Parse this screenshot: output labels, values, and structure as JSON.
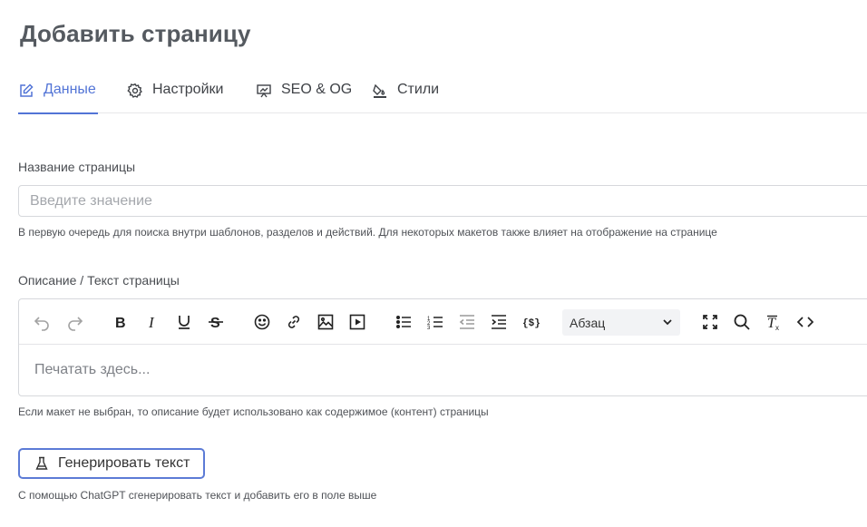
{
  "page": {
    "title": "Добавить страницу"
  },
  "tabs": [
    {
      "label": "Данные",
      "icon": "edit-icon",
      "active": true
    },
    {
      "label": "Настройки",
      "icon": "gear-icon",
      "active": false
    },
    {
      "label": "SEO & OG",
      "icon": "presentation-icon",
      "active": false
    },
    {
      "label": "Стили",
      "icon": "paint-bucket-icon",
      "active": false
    }
  ],
  "page_name": {
    "label": "Название страницы",
    "placeholder": "Введите значение",
    "value": "",
    "hint": "В первую очередь для поиска внутри шаблонов, разделов и действий. Для некоторых макетов также влияет на отображение на странице"
  },
  "description": {
    "label": "Описание / Текст страницы",
    "placeholder": "Печатать здесь...",
    "hint": "Если макет не выбран, то описание будет использовано как содержимое (контент) страницы",
    "toolbar": {
      "format_select": "Абзац",
      "buttons": [
        "undo-icon",
        "redo-icon",
        "bold-icon",
        "italic-icon",
        "underline-icon",
        "strikethrough-icon",
        "emoji-icon",
        "link-icon",
        "image-icon",
        "video-icon",
        "bullet-list-icon",
        "numbered-list-icon",
        "outdent-icon",
        "indent-icon",
        "template-vars-icon",
        "fullscreen-icon",
        "search-icon",
        "clear-format-icon",
        "source-code-icon"
      ]
    }
  },
  "generate": {
    "button_label": "Генерировать текст",
    "hint": "С помощью ChatGPT сгенерировать текст и добавить его в поле выше"
  },
  "colors": {
    "accent": "#5274d6",
    "text": "#3a3a3a",
    "border": "#d6d8dc"
  }
}
